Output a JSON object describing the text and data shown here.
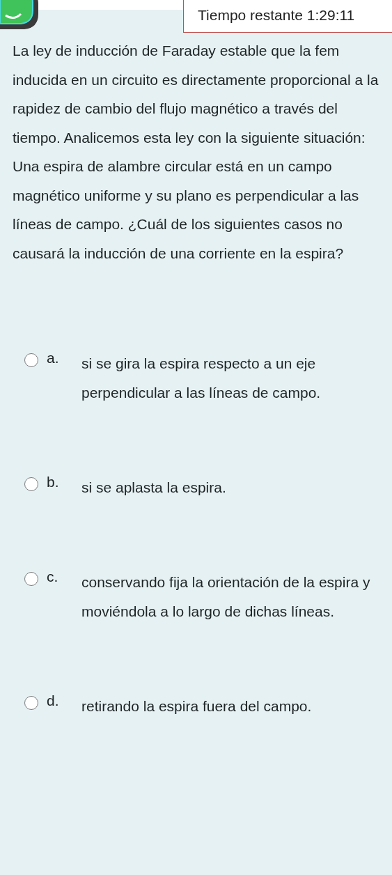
{
  "timer": {
    "text": "Tiempo restante 1:29:11"
  },
  "question": {
    "text": "La ley de inducción de Faraday estable que la fem inducida en un circuito es directamente proporcional a la rapidez de cambio del flujo magnético a través del tiempo. Analicemos esta ley con la siguiente situación: Una espira de alambre circular está en un campo magnético uniforme y su plano es perpendicular a las líneas de campo. ¿Cuál de los siguientes casos no causará la inducción de una corriente en la espira?"
  },
  "options": [
    {
      "letter": "a.",
      "text": "si se gira la espira respecto a un eje perpendicular a las líneas de campo.",
      "selected": false
    },
    {
      "letter": "b.",
      "text": "si se aplasta la espira.",
      "selected": false
    },
    {
      "letter": "c.",
      "text": "conservando fija la orientación de la espira y moviéndola a lo largo de dichas líneas.",
      "selected": false
    },
    {
      "letter": "d.",
      "text": "retirando la espira fuera del campo.",
      "selected": false
    }
  ]
}
